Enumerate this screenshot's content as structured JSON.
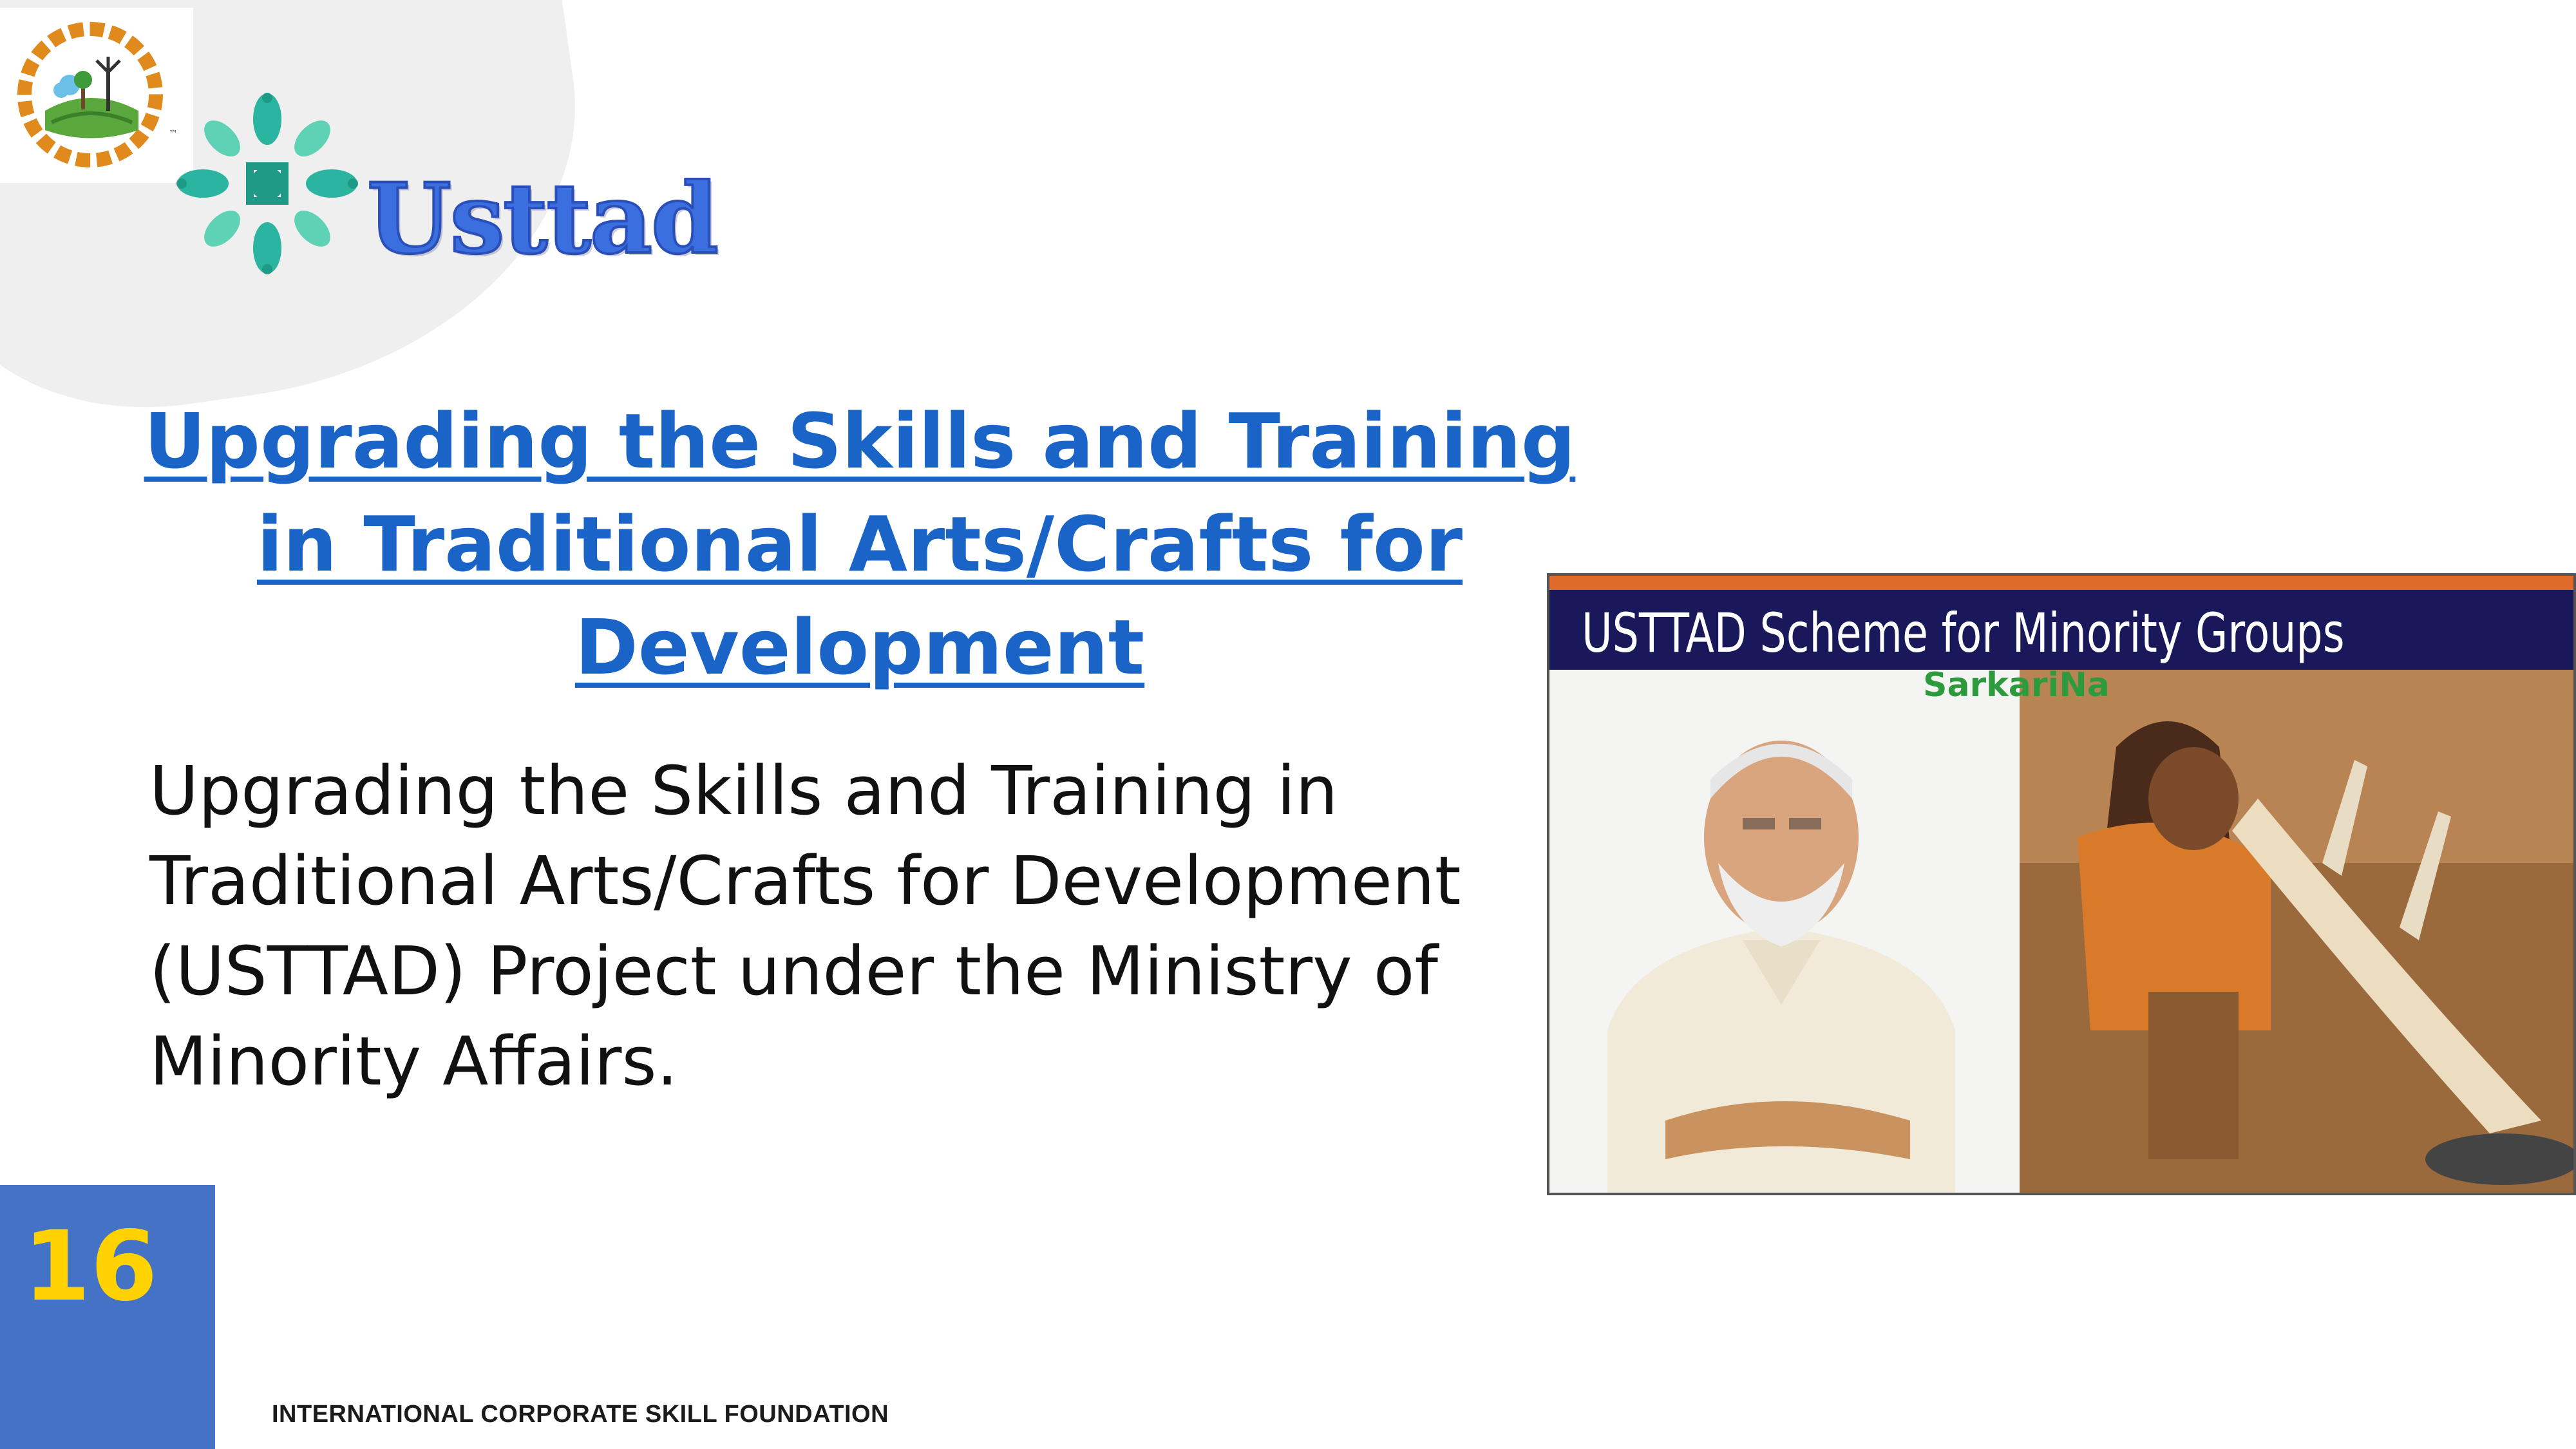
{
  "logos": {
    "icsf_logo_icon": "gear-landscape-logo-icon",
    "icsf_logo_arc_text": "International Corporate Skill Foundation",
    "usttad_logo_icon": "flower-mandala-logo-icon",
    "usttad_wordmark": "Usttad"
  },
  "slide": {
    "headline": "Upgrading the Skills and Training in Traditional Arts/Crafts for Development",
    "body": "Upgrading the Skills and Training in Traditional Arts/Crafts for Development (USTTAD) Project under the Ministry of Minority Affairs.",
    "number": "16"
  },
  "photo": {
    "title": "USTTAD Scheme for Minority Groups",
    "watermark": "SarkariNa"
  },
  "footer": {
    "text": "INTERNATIONAL CORPORATE SKILL FOUNDATION"
  },
  "colors": {
    "headline": "#1a64c8",
    "slide_number_box": "#4472c4",
    "slide_number": "#ffd200",
    "photo_title_bar": "#18185a",
    "usttad_wordmark": "#3b6fe0"
  }
}
